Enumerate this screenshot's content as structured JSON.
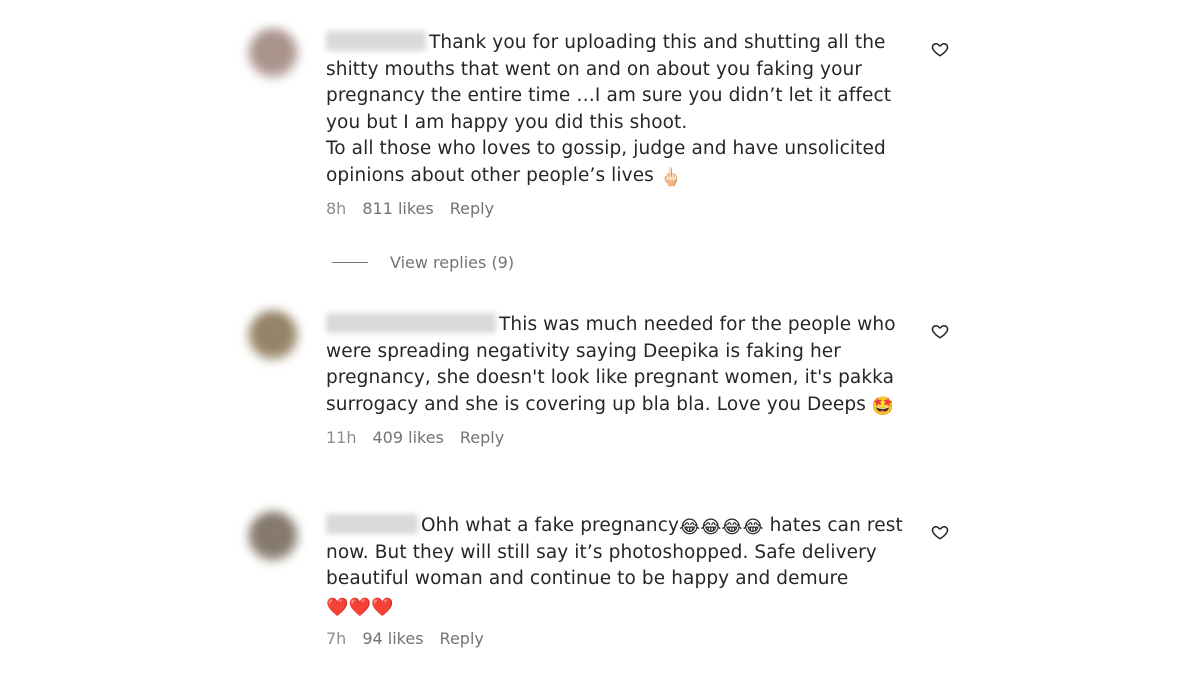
{
  "comments": [
    {
      "text_part1": "Thank you for uploading this and shutting all the shitty mouths that went on and on about you faking your pregnancy the entire time …I am sure you didn’t let it affect you but I am happy you did this shoot.",
      "text_part2": "To all those who loves to gossip, judge and have unsolicited opinions about other people’s lives",
      "emoji": "🖕🏻",
      "time": "8h",
      "likes": "811 likes",
      "reply": "Reply",
      "view_replies": "View replies (9)",
      "like_icon": "heart-outline-icon"
    },
    {
      "text": "This was much needed for the people who were spreading negativity saying Deepika is faking her pregnancy, she doesn't look like pregnant women, it's pakka surrogacy and she is covering up bla bla. Love you Deeps",
      "emoji": "🤩",
      "time": "11h",
      "likes": "409 likes",
      "reply": "Reply",
      "like_icon": "heart-outline-icon"
    },
    {
      "text_part1": "Ohh what a fake pregnancy",
      "emoji_laugh": "😂😂😂😂",
      "text_part2": " hates can rest now. But they will still say it’s photoshopped. Safe delivery beautiful woman and continue to be happy and demure",
      "emoji_hearts": "❤️❤️❤️",
      "time": "7h",
      "likes": "94 likes",
      "reply": "Reply",
      "like_icon": "heart-outline-icon"
    }
  ],
  "colors": {
    "text": "#262626",
    "meta": "#737373",
    "background": "#ffffff"
  }
}
